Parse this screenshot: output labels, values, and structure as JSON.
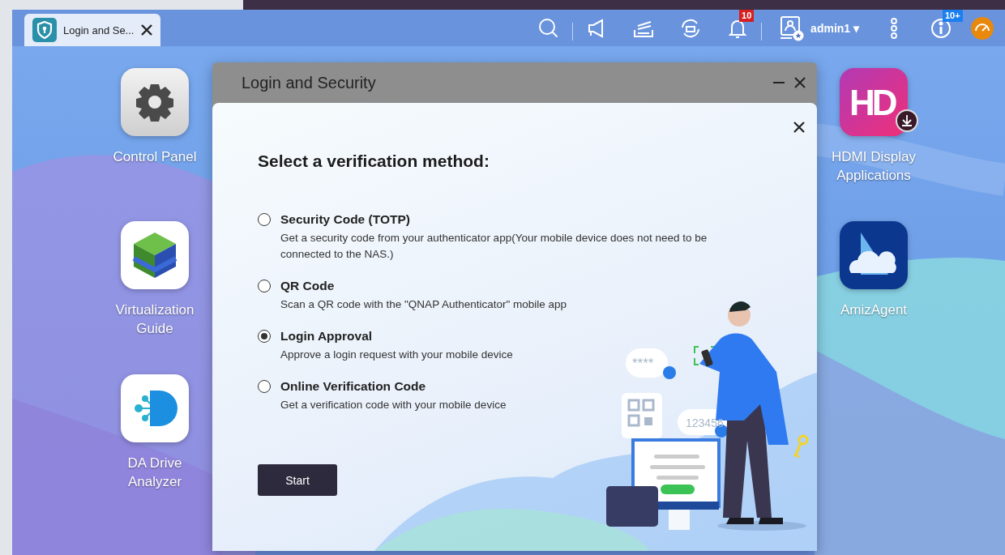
{
  "taskbar": {
    "tabs": [
      {
        "label": "Login and Se...",
        "selected": true
      }
    ],
    "notification_badge": "10",
    "user": "admin1",
    "caret": "▾",
    "info_badge": "10+"
  },
  "desktop_icons": {
    "left_column": [
      {
        "kind": "control-panel",
        "label": "Control Panel"
      },
      {
        "kind": "virtualization",
        "label": "Virtualization Guide"
      },
      {
        "kind": "da-drive",
        "label": "DA Drive Analyzer"
      }
    ],
    "right_column": [
      {
        "kind": "hdmi",
        "label": "HDMI Display Applications",
        "logo_text": "HD"
      },
      {
        "kind": "amiz",
        "label": "AmizAgent"
      }
    ]
  },
  "window": {
    "title": "Login and Security"
  },
  "dialog": {
    "heading": "Select a verification method:",
    "options": [
      {
        "title": "Security Code (TOTP)",
        "description": "Get a security code from your authenticator app(Your mobile device does not need to be connected to the NAS.)",
        "selected": false
      },
      {
        "title": "QR Code",
        "description": "Scan a QR code with the \"QNAP Authenticator\" mobile app",
        "selected": false
      },
      {
        "title": "Login Approval",
        "description": "Approve a login request with your mobile device",
        "selected": true
      },
      {
        "title": "Online Verification Code",
        "description": "Get a verification code with your mobile device",
        "selected": false
      }
    ],
    "button": "Start",
    "illustration": {
      "password_bubble": "****",
      "code_bubble": "123456"
    }
  }
}
